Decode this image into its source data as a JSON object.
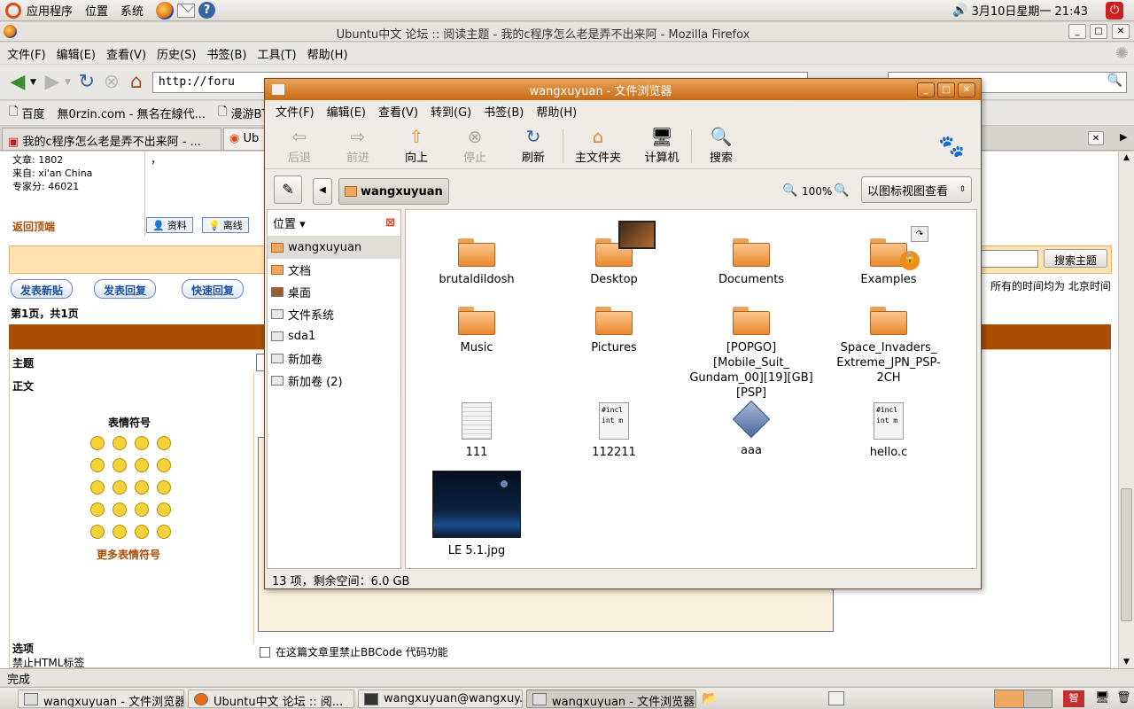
{
  "top_panel": {
    "menus": [
      "应用程序",
      "位置",
      "系统"
    ],
    "datetime": "3月10日星期一 21:43"
  },
  "firefox": {
    "title": "Ubuntu中文 论坛 :: 阅读主题 - 我的c程序怎么老是弄不出来阿 - Mozilla Firefox",
    "menu": [
      "文件(F)",
      "编辑(E)",
      "查看(V)",
      "历史(S)",
      "书签(B)",
      "工具(T)",
      "帮助(H)"
    ],
    "url": "http://foru",
    "bookmarks": [
      "百度",
      "無0rzin.com - 無名在線代...",
      "漫游BT"
    ],
    "tabs": [
      "我的c程序怎么老是弄不出来阿 - ...",
      "Ub"
    ],
    "status": "完成"
  },
  "forum": {
    "user_stats": [
      "文章: 1802",
      "来自: xi'an China",
      "专家分: 46021"
    ],
    "back_top": "返回顶端",
    "profile_btn": "资料",
    "offline_btn": "离线",
    "post_new": "发表新贴",
    "post_reply": "发表回复",
    "quick_reply": "快速回复",
    "page_info": "第1页，共1页",
    "search_topic": "搜索主题",
    "timezone": "所有的时间均为 北京时间",
    "subject_label": "主题",
    "body_label": "正文",
    "smilies_title": "表情符号",
    "more_smilies": "更多表情符号",
    "options_label": "选项",
    "html_off": "禁止HTML标签",
    "bbcode_off": "在这篇文章里禁止BBCode 代码功能",
    "comma": "，"
  },
  "nautilus": {
    "title": "wangxuyuan - 文件浏览器",
    "menu": [
      "文件(F)",
      "编辑(E)",
      "查看(V)",
      "转到(G)",
      "书签(B)",
      "帮助(H)"
    ],
    "toolbar": {
      "back": "后退",
      "forward": "前进",
      "up": "向上",
      "stop": "停止",
      "reload": "刷新",
      "home": "主文件夹",
      "computer": "计算机",
      "search": "搜索"
    },
    "location": "wangxuyuan",
    "zoom": "100%",
    "view_mode": "以图标视图查看",
    "sidebar_title": "位置",
    "sidebar": [
      "wangxuyuan",
      "文档",
      "桌面",
      "文件系统",
      "sda1",
      "新加卷",
      "新加卷 (2)"
    ],
    "files": [
      {
        "name": "brutaldildosh",
        "kind": "folder"
      },
      {
        "name": "Desktop",
        "kind": "folder"
      },
      {
        "name": "Documents",
        "kind": "folder"
      },
      {
        "name": "Examples",
        "kind": "folder-locked"
      },
      {
        "name": "Music",
        "kind": "folder"
      },
      {
        "name": "Pictures",
        "kind": "folder"
      },
      {
        "name": "[POPGO][Mobile_Suit_ Gundam_00][19][GB] [PSP]",
        "kind": "folder"
      },
      {
        "name": "Space_Invaders_ Extreme_JPN_PSP-2CH",
        "kind": "folder"
      },
      {
        "name": "111",
        "kind": "text"
      },
      {
        "name": "112211",
        "kind": "c-source"
      },
      {
        "name": "aaa",
        "kind": "binary"
      },
      {
        "name": "hello.c",
        "kind": "c-source"
      },
      {
        "name": "LE 5.1.jpg",
        "kind": "image"
      }
    ],
    "doc_preview": [
      "#incl",
      "int m"
    ],
    "status": "13 项，剩余空间：6.0 GB"
  },
  "bottom_panel": {
    "tasks": [
      "wangxuyuan - 文件浏览器",
      "Ubuntu中文 论坛 :: 阅...",
      "wangxuyuan@wangxuy...",
      "wangxuyuan - 文件浏览器"
    ]
  }
}
